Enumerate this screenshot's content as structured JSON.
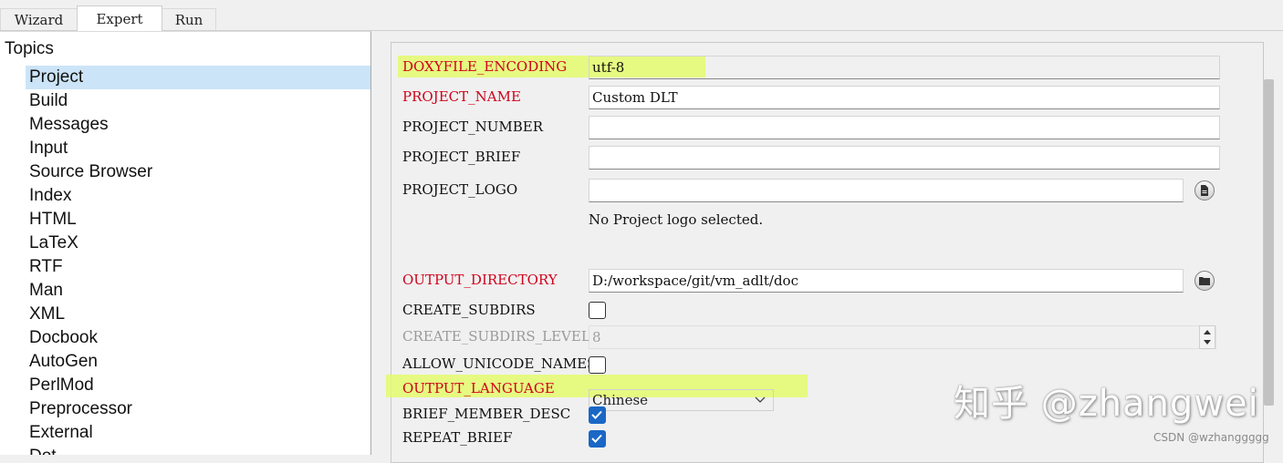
{
  "tabs": [
    "Wizard",
    "Expert",
    "Run"
  ],
  "topics": {
    "heading": "Topics",
    "items": [
      "Project",
      "Build",
      "Messages",
      "Input",
      "Source Browser",
      "Index",
      "HTML",
      "LaTeX",
      "RTF",
      "Man",
      "XML",
      "Docbook",
      "AutoGen",
      "PerlMod",
      "Preprocessor",
      "External",
      "Dot"
    ]
  },
  "settings": {
    "doxyfile_encoding": {
      "label": "DOXYFILE_ENCODING",
      "value": "utf-8"
    },
    "project_name": {
      "label": "PROJECT_NAME",
      "value": "Custom DLT"
    },
    "project_number": {
      "label": "PROJECT_NUMBER",
      "value": ""
    },
    "project_brief": {
      "label": "PROJECT_BRIEF",
      "value": ""
    },
    "project_logo": {
      "label": "PROJECT_LOGO",
      "value": "",
      "note": "No Project logo selected."
    },
    "output_directory": {
      "label": "OUTPUT_DIRECTORY",
      "value": "D:/workspace/git/vm_adlt/doc"
    },
    "create_subdirs": {
      "label": "CREATE_SUBDIRS",
      "checked": false
    },
    "create_subdirs_level": {
      "label": "CREATE_SUBDIRS_LEVEL",
      "value": "8"
    },
    "allow_unicode_names": {
      "label": "ALLOW_UNICODE_NAMES",
      "checked": false
    },
    "output_language": {
      "label": "OUTPUT_LANGUAGE",
      "value": "Chinese"
    },
    "brief_member_desc": {
      "label": "BRIEF_MEMBER_DESC",
      "checked": true
    },
    "repeat_brief": {
      "label": "REPEAT_BRIEF",
      "checked": true
    }
  },
  "colors": {
    "highlight": "#e4fa6d",
    "modified_label": "#d0021b",
    "checkbox_on": "#1a67c6",
    "selection": "#cce4f7"
  },
  "icons": {
    "logo_browse": "file-icon",
    "dir_browse": "folder-icon",
    "select_arrow": "chevron-down-icon",
    "spin": "spin-arrows-icon"
  },
  "watermark": "知乎 @zhangwei",
  "csdn": "CSDN @wzhanggggg"
}
